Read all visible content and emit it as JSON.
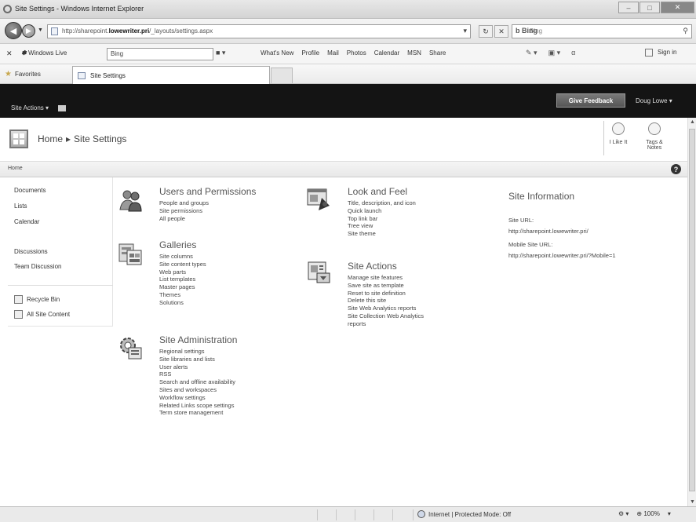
{
  "window": {
    "title": "Site Settings - Windows Internet Explorer",
    "buttons": [
      "–",
      "□",
      "✕"
    ]
  },
  "address": {
    "url_prefix": "http://sharepoint.",
    "url_domain": "lowewriter.pri",
    "url_path": "/_layouts/settings.aspx",
    "search_engine": "b Bing",
    "search_placeholder": "Bing"
  },
  "windows_live": {
    "logo": "Windows Live",
    "search_value": "Bing",
    "links": [
      "What's New",
      "Profile",
      "Mail",
      "Photos",
      "Calendar",
      "MSN",
      "Share"
    ],
    "sign_in": "Sign in"
  },
  "favorites": {
    "label": "Favorites",
    "tab_label": "Site Settings"
  },
  "sharepoint": {
    "site_actions": "Site Actions ▾",
    "give_feedback": "Give Feedback",
    "user": "Doug Lowe ▾",
    "breadcrumb_home": "Home",
    "breadcrumb_sep": "▸",
    "breadcrumb_page": "Site Settings",
    "i_like_it": "I Like It",
    "tags_notes": "Tags & Notes",
    "nav_home": "Home"
  },
  "quick_launch": {
    "items": [
      "Documents",
      "Lists",
      "Calendar",
      "Discussions",
      "Team Discussion"
    ],
    "recycle_bin": "Recycle Bin",
    "all_site_content": "All Site Content"
  },
  "sections": {
    "users": {
      "title": "Users and Permissions",
      "links": [
        "People and groups",
        "Site permissions",
        "All people"
      ]
    },
    "galleries": {
      "title": "Galleries",
      "links": [
        "Site columns",
        "Site content types",
        "Web parts",
        "List templates",
        "Master pages",
        "Themes",
        "Solutions"
      ]
    },
    "admin": {
      "title": "Site Administration",
      "links": [
        "Regional settings",
        "Site libraries and lists",
        "User alerts",
        "RSS",
        "Search and offline availability",
        "Sites and workspaces",
        "Workflow settings",
        "Related Links scope settings",
        "Term store management"
      ]
    },
    "look": {
      "title": "Look and Feel",
      "links": [
        "Title, description, and icon",
        "Quick launch",
        "Top link bar",
        "Tree view",
        "Site theme"
      ]
    },
    "actions": {
      "title": "Site Actions",
      "links": [
        "Manage site features",
        "Save site as template",
        "Reset to site definition",
        "Delete this site",
        "Site Web Analytics reports",
        "Site Collection Web Analytics",
        "reports"
      ]
    }
  },
  "site_info": {
    "title": "Site Information",
    "site_url_label": "Site URL:",
    "site_url": "http://sharepoint.lowewriter.pri/",
    "mobile_url_label": "Mobile Site URL:",
    "mobile_url": "http://sharepoint.lowewriter.pri/?Mobile=1"
  },
  "status": {
    "zone": "Internet | Protected Mode: Off",
    "zoom": "⊕ 100%"
  }
}
